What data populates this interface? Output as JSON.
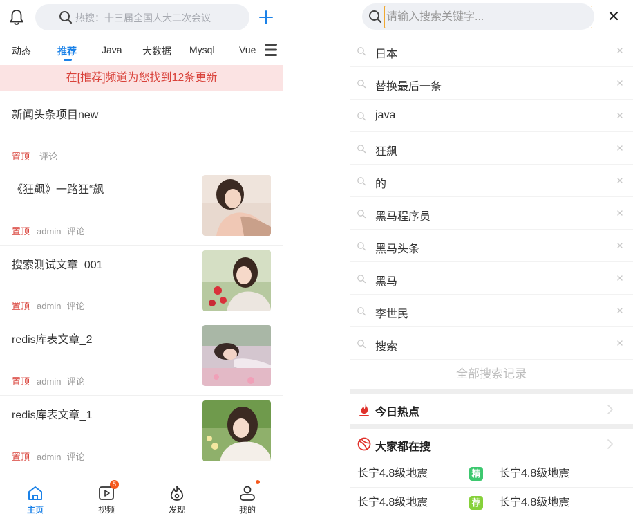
{
  "left": {
    "search_placeholder": "热搜：十三届全国人大二次会议",
    "tabs": [
      {
        "label": "动态"
      },
      {
        "label": "推荐"
      },
      {
        "label": "Java"
      },
      {
        "label": "大数据"
      },
      {
        "label": "Mysql"
      },
      {
        "label": "Vue"
      }
    ],
    "active_tab": "推荐",
    "banner": "在[推荐]频道为您找到12条更新",
    "articles": [
      {
        "title": "新闻头条项目new",
        "top": "置顶",
        "author": "",
        "comment": "评论"
      },
      {
        "title": "《狂飙》一路狂“飙",
        "top": "置顶",
        "author": "admin",
        "comment": "评论"
      },
      {
        "title": "搜索测试文章_001",
        "top": "置顶",
        "author": "admin",
        "comment": "评论"
      },
      {
        "title": "redis库表文章_2",
        "top": "置顶",
        "author": "admin",
        "comment": "评论"
      },
      {
        "title": "redis库表文章_1",
        "top": "置顶",
        "author": "admin",
        "comment": "评论"
      }
    ],
    "nav": [
      {
        "label": "主页",
        "icon": "home-icon"
      },
      {
        "label": "视频",
        "icon": "video-icon",
        "badge": "5"
      },
      {
        "label": "发现",
        "icon": "discover-icon"
      },
      {
        "label": "我的",
        "icon": "profile-icon"
      }
    ]
  },
  "right": {
    "search_placeholder": "请输入搜索关键字...",
    "history": [
      "日本",
      "替换最后一条",
      "java",
      "狂飙",
      "的",
      "黑马程序员",
      "黑马头条",
      "黑马",
      "李世民",
      "搜索"
    ],
    "all_history": "全部搜索记录",
    "today_hot": "今日热点",
    "everyone_searching": "大家都在搜",
    "hot_rows": [
      {
        "left": "长宁4.8级地震",
        "tag": "精",
        "right": "长宁4.8级地震"
      },
      {
        "left": "长宁4.8级地震",
        "tag": "荐",
        "right": "长宁4.8级地震"
      }
    ]
  },
  "colors": {
    "accent": "#1b82e8",
    "banner_bg": "#fbe3e3",
    "top_red": "#d9423a",
    "tag_jing": "#3dc86f",
    "tag_jian": "#86d13a",
    "badge": "#f5591d"
  }
}
